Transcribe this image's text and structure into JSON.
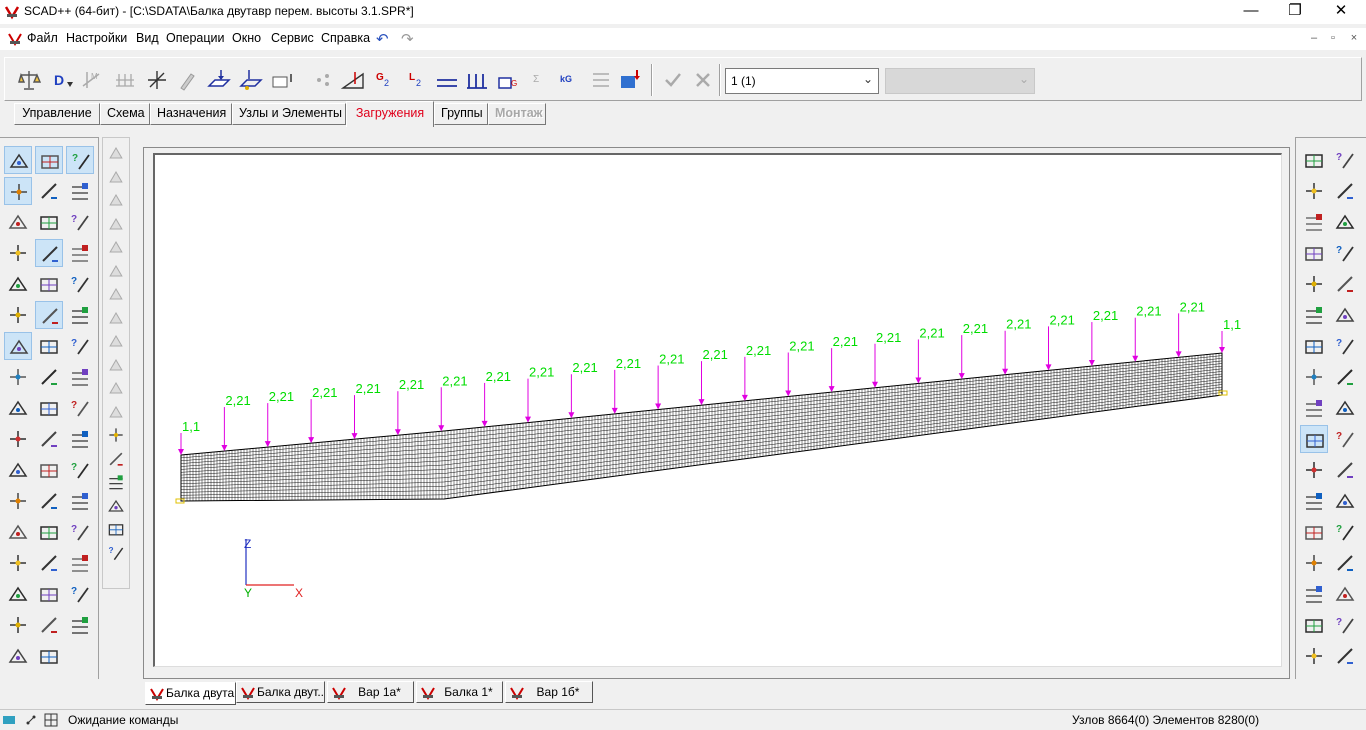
{
  "window": {
    "title": "SCAD++ (64-бит) - [C:\\SDATA\\Балка двутавр перем. высоты 3.1.SPR*]",
    "minimize": "—",
    "restore": "❐",
    "close": "✕"
  },
  "menu": {
    "items": [
      "Файл",
      "Настройки",
      "Вид",
      "Операции",
      "Окно",
      "Сервис",
      "Справка"
    ],
    "undo": "↶",
    "redo": "↷",
    "mdi": [
      "–",
      "▫",
      "×"
    ]
  },
  "toolbar": {
    "loadcase_value": "1 (1)",
    "combo_arrow": "⌄",
    "icons": [
      "scales-icon",
      "d-load-icon",
      "mx-icon",
      "grid-load-icon",
      "axes-icon",
      "pin-icon",
      "surface-load-icon",
      "nodal-load-icon",
      "element-load-icon",
      "nodes-icon",
      "triangle-load-icon",
      "g2-icon",
      "l2-icon",
      "beam-load-icon",
      "beam-load2-icon",
      "wg-icon",
      "spec-icon",
      "kg-icon",
      "mass-icon",
      "gear-save-icon"
    ]
  },
  "tabs": [
    "Управление",
    "Схема",
    "Назначения",
    "Узлы и Элементы",
    "Загружения",
    "Группы",
    "Монтаж"
  ],
  "active_tab": "Загружения",
  "canvas": {
    "loads": [
      "1,1",
      "2,21",
      "2,21",
      "2,21",
      "2,21",
      "2,21",
      "2,21",
      "2,21",
      "2,21",
      "2,21",
      "2,21",
      "2,21",
      "2,21",
      "2,21",
      "2,21",
      "2,21",
      "2,21",
      "2,21",
      "2,21",
      "2,21",
      "2,21",
      "2,21",
      "2,21",
      "2,21",
      "1,1"
    ],
    "axes": {
      "z": "Z",
      "y": "Y",
      "x": "X"
    },
    "load_color": "#e000e0",
    "label_color": "#00dd00"
  },
  "doc_tabs": [
    "Балка двута...",
    "Балка двут...",
    "Вар 1а*",
    "Балка 1*",
    "Вар 1б*"
  ],
  "status": {
    "text": "Ожидание команды",
    "counts": "Узлов 8664(0) Элементов 8280(0)"
  }
}
